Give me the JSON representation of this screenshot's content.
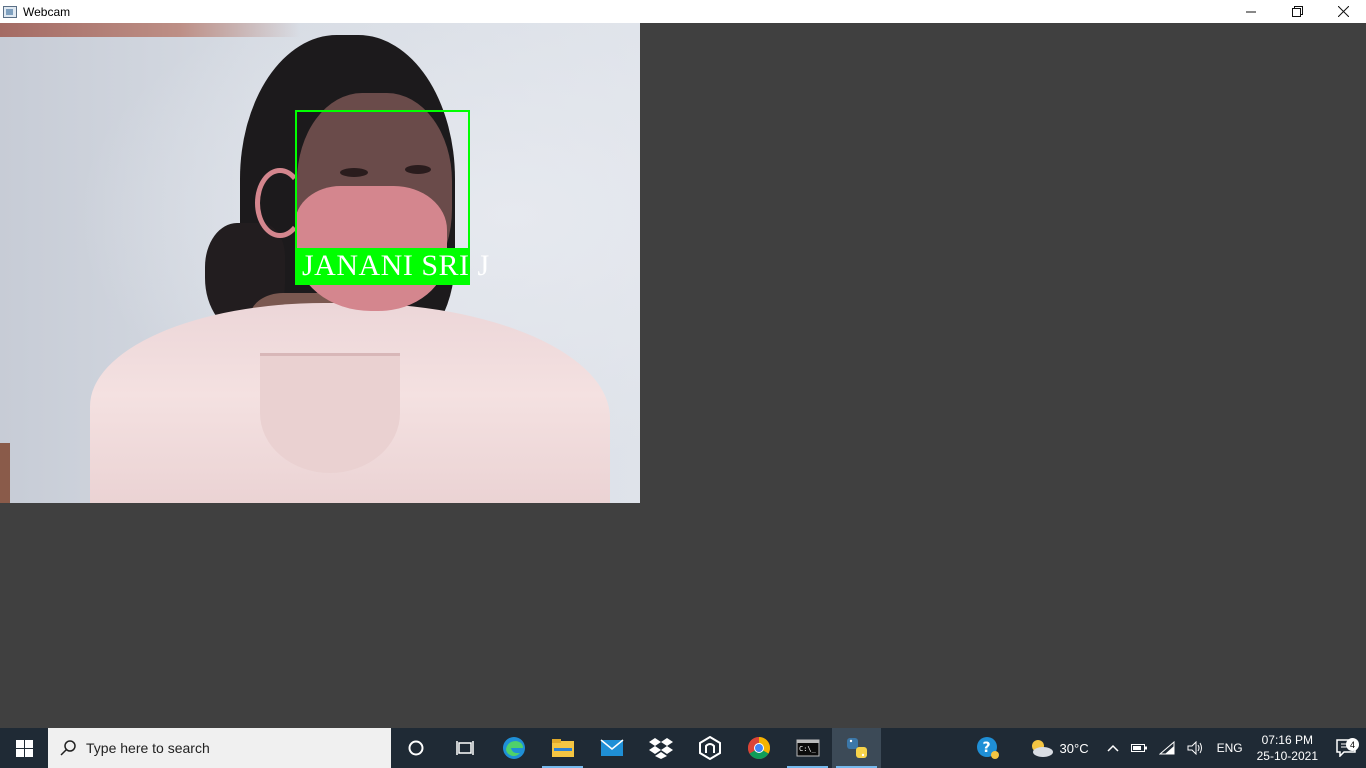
{
  "window": {
    "title": "Webcam",
    "controls": {
      "minimize_icon": "minimize-icon",
      "restore_icon": "restore-icon",
      "close_icon": "close-icon"
    }
  },
  "webcam": {
    "detection_label": "JANANI SRI J",
    "box_color": "#00ff00"
  },
  "taskbar": {
    "search_placeholder": "Type here to search",
    "pinned": [
      {
        "name": "cortana-icon"
      },
      {
        "name": "task-view-icon"
      },
      {
        "name": "edge-icon"
      },
      {
        "name": "file-explorer-icon"
      },
      {
        "name": "mail-icon"
      },
      {
        "name": "dropbox-icon"
      },
      {
        "name": "app-icon"
      },
      {
        "name": "chrome-icon"
      },
      {
        "name": "terminal-icon"
      },
      {
        "name": "python-icon"
      }
    ],
    "tray": {
      "temperature": "30°C",
      "language": "ENG",
      "time": "07:16 PM",
      "date": "25-10-2021",
      "notification_count": "4"
    }
  }
}
